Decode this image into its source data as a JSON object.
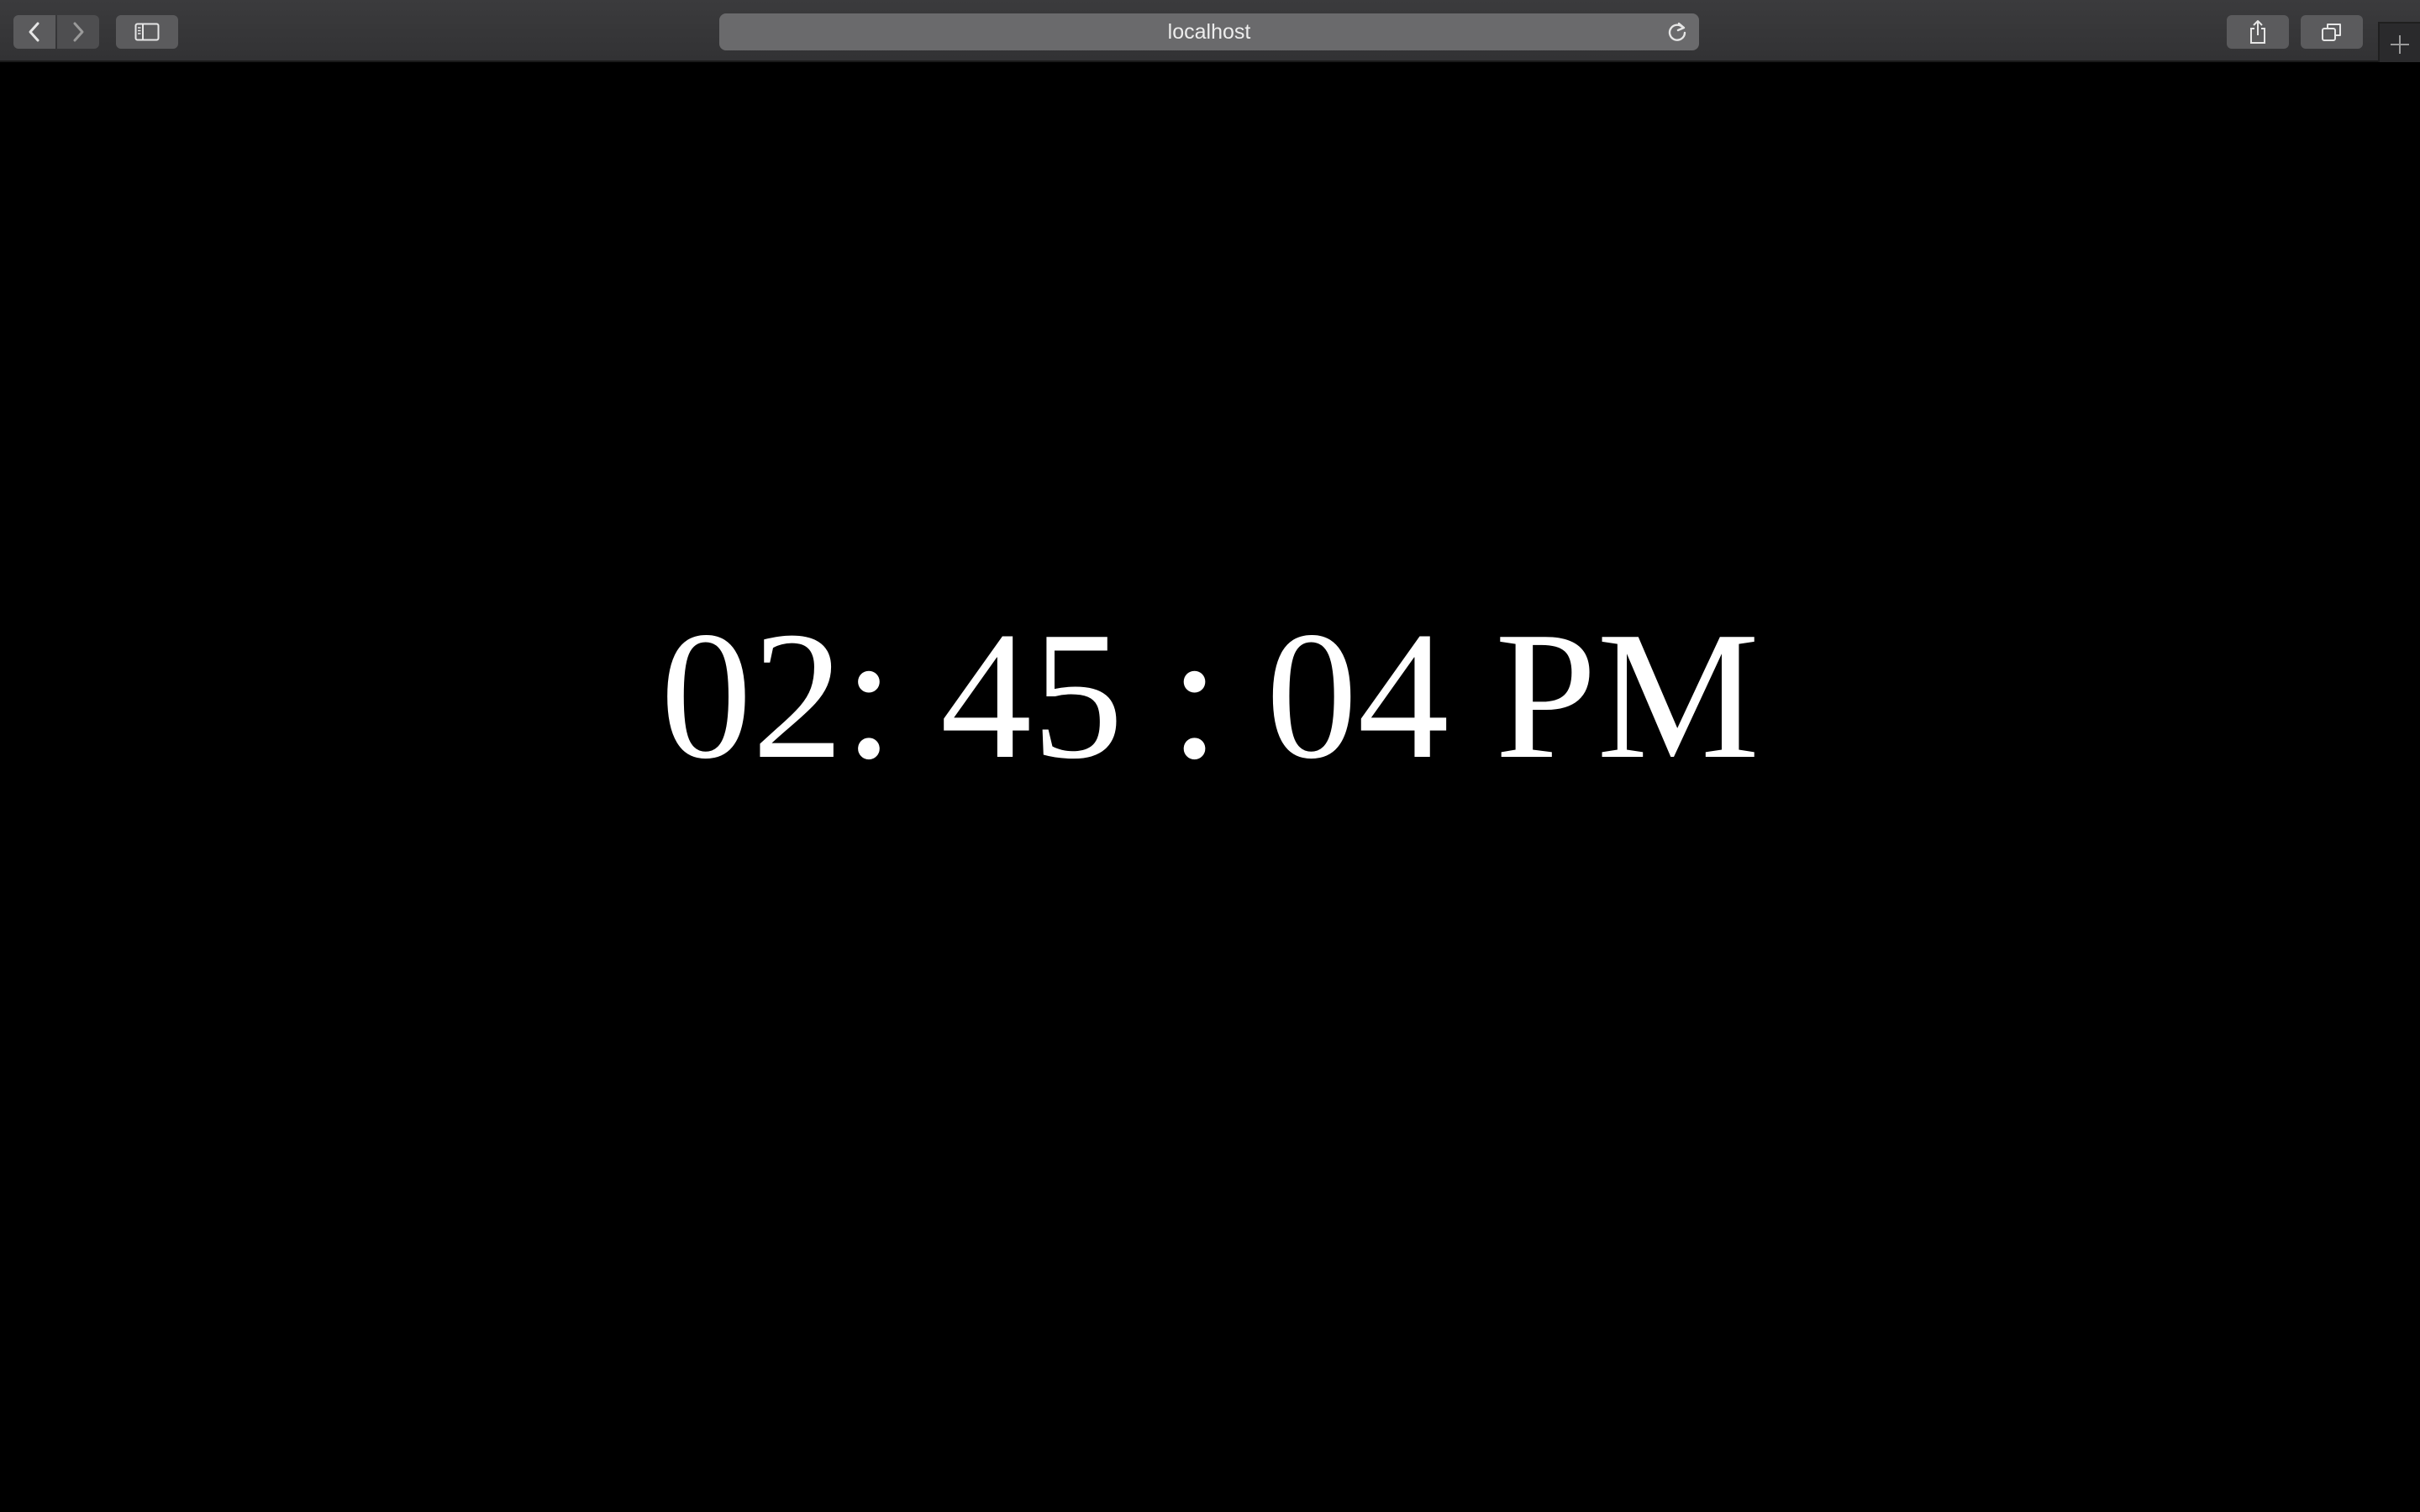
{
  "browser": {
    "address": "localhost",
    "icons": {
      "back": "chevron-left-icon",
      "forward": "chevron-right-icon",
      "sidebar": "sidebar-icon",
      "reload": "reload-icon",
      "share": "share-icon",
      "tabs": "tabs-overview-icon",
      "new_tab": "plus-icon"
    }
  },
  "page": {
    "background": "#000000",
    "text_color": "#ffffff",
    "clock": {
      "hours": "02",
      "sep1": ": ",
      "minutes": "45",
      "sep2": " : ",
      "seconds": "04",
      "period": "PM"
    }
  }
}
